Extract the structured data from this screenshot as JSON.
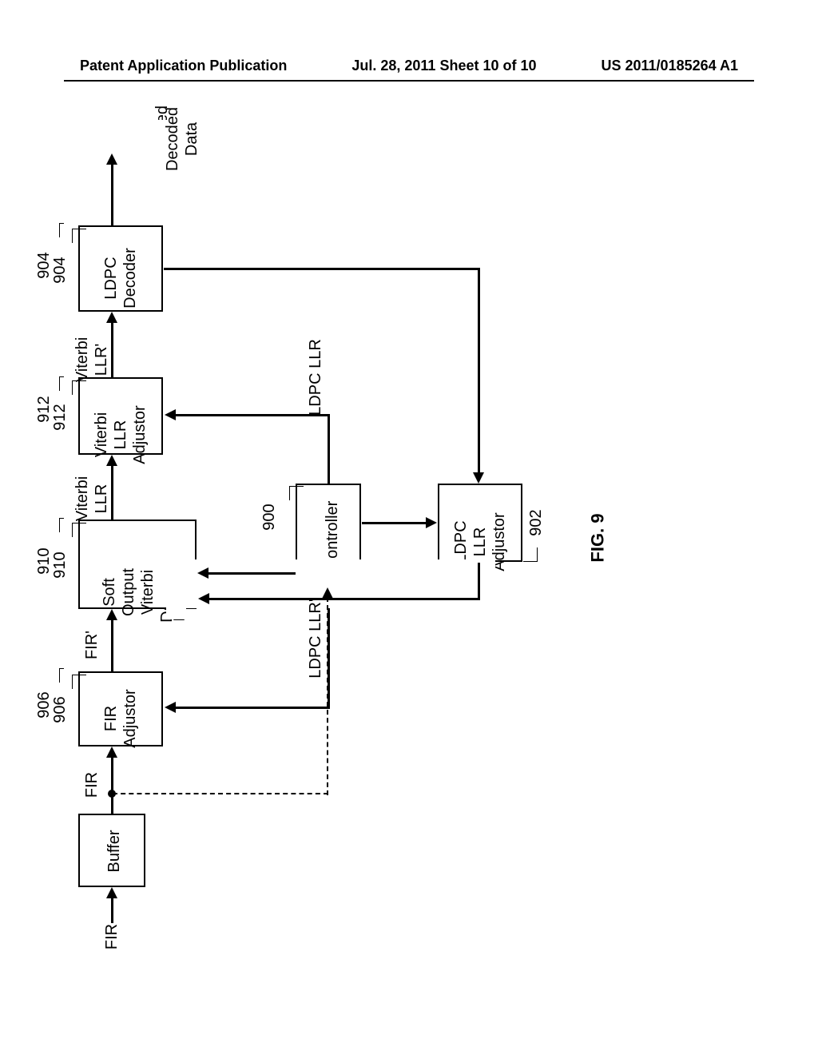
{
  "header": {
    "left": "Patent Application Publication",
    "center": "Jul. 28, 2011  Sheet 10 of 10",
    "right": "US 2011/0185264 A1"
  },
  "labels": {
    "fir_in": "FIR",
    "buffer": "Buffer",
    "fir_after_buffer": "FIR",
    "fir_adjustor": "FIR\nAdjustor",
    "ref_906": "906",
    "fir_prime": "FIR'",
    "sova": "Soft\nOutput\nViterbi\nDecoder",
    "ref_910": "910",
    "viterbi_llr": "Viterbi\nLLR",
    "viterbi_adjustor": "Viterbi\nLLR\nAdjustor",
    "ref_912": "912",
    "viterbi_llr_prime": "Viterbi\nLLR'",
    "ldpc_decoder": "LDPC\nDecoder",
    "ref_904": "904",
    "decoded_data": "Decoded\nData",
    "controller": "Controller",
    "ref_900": "900",
    "ldpc_adjustor": "LDPC\nLLR\nAdjustor",
    "ref_902": "902",
    "ldpc_llr": "LDPC LLR",
    "ldpc_llr_prime": "LDPC LLR'",
    "figure": "FIG. 9"
  }
}
